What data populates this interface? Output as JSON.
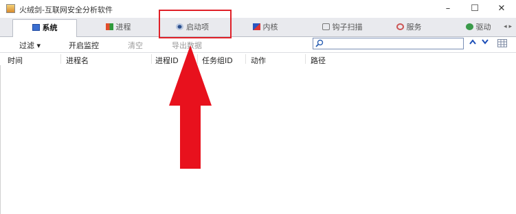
{
  "window": {
    "title": "火绒剑-互联网安全分析软件",
    "controls": {
      "minimize": "–",
      "maximize": "☐",
      "close": "✕"
    }
  },
  "tabs": [
    {
      "label": "系统",
      "icon": "monitor-icon",
      "active": true
    },
    {
      "label": "进程",
      "icon": "process-icon",
      "active": false
    },
    {
      "label": "启动项",
      "icon": "startup-eye-icon",
      "active": false
    },
    {
      "label": "内核",
      "icon": "kernel-icon",
      "active": false
    },
    {
      "label": "钩子扫描",
      "icon": "hook-icon",
      "active": false
    },
    {
      "label": "服务",
      "icon": "service-icon",
      "active": false
    },
    {
      "label": "驱动",
      "icon": "driver-icon",
      "active": false
    }
  ],
  "tab_scroll": "◂ ▸",
  "toolbar": {
    "filter": "过滤 ▾",
    "start_monitor": "开启监控",
    "clear": "清空",
    "export_data": "导出数据"
  },
  "search": {
    "value": "",
    "placeholder": ""
  },
  "nav": {
    "up": "⌃",
    "down": "⌄"
  },
  "columns": [
    "时间",
    "进程名",
    "进程ID",
    "任务组ID",
    "动作",
    "路径"
  ],
  "annotation": {
    "highlight_color": "#e01f27",
    "arrow_color": "#e8111d"
  }
}
